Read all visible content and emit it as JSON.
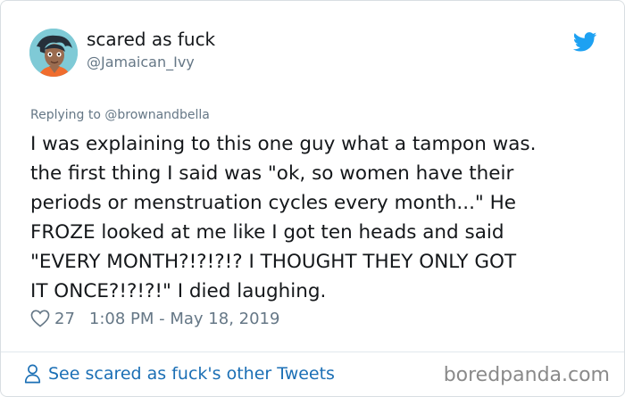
{
  "author": {
    "display_name": "scared as fuck",
    "handle": "@Jamaican_Ivy"
  },
  "icons": {
    "brand": "twitter-bird-icon",
    "like": "heart-icon",
    "profile": "person-icon"
  },
  "reply": {
    "text": "Replying to @brownandbella"
  },
  "tweet": {
    "text": "I was explaining to this one guy what a tampon was.\nthe first thing I said was \"ok, so women have their\nperiods or menstruation cycles every month...\" He\nFROZE looked at me like I got ten heads and said\n\"EVERY MONTH?!?!?!? I THOUGHT THEY ONLY GOT\nIT ONCE?!?!?!\" I died laughing."
  },
  "meta": {
    "likes": "27",
    "timestamp": "1:08 PM - May 18, 2019"
  },
  "footer": {
    "link_text": "See scared as fuck's other Tweets"
  },
  "watermark": "boredpanda.com",
  "colors": {
    "twitter_blue": "#1da1f2",
    "link_blue": "#1b6fb5",
    "muted_text": "#657786",
    "primary_text": "#14171a"
  }
}
